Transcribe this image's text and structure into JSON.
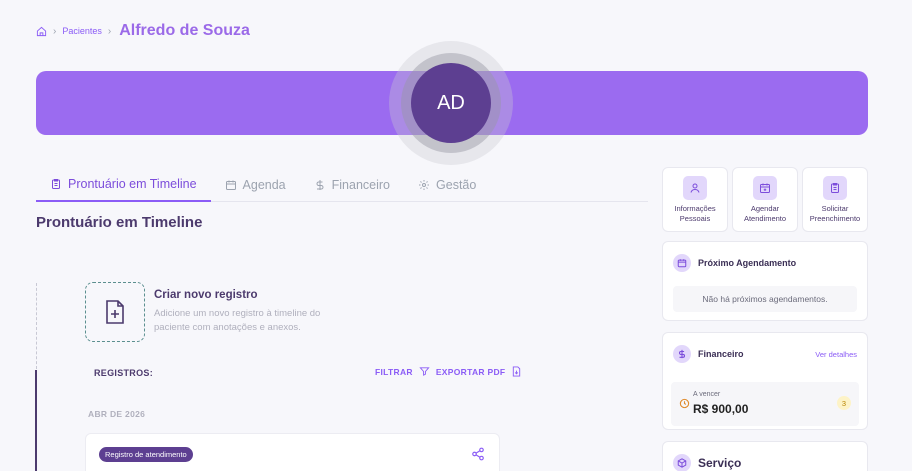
{
  "breadcrumb": {
    "parent": "Pacientes",
    "current": "Alfredo de Souza"
  },
  "avatar": {
    "initials": "AD"
  },
  "tabs": [
    {
      "label": "Prontuário em Timeline",
      "active": true
    },
    {
      "label": "Agenda"
    },
    {
      "label": "Financeiro"
    },
    {
      "label": "Gestão"
    }
  ],
  "section_title": "Prontuário em Timeline",
  "new_record": {
    "title": "Criar novo registro",
    "description": "Adicione um novo registro à timeline do paciente com anotações e anexos."
  },
  "records": {
    "label": "REGISTROS:",
    "filter": "FILTRAR",
    "export": "EXPORTAR PDF"
  },
  "month": "ABR DE 2026",
  "record_badge": "Registro de atendimento",
  "quick_actions": [
    {
      "label": "Informações Pessoais"
    },
    {
      "label": "Agendar Atendimento"
    },
    {
      "label": "Solicitar Preenchimento"
    }
  ],
  "next_appointment": {
    "title": "Próximo Agendamento",
    "empty": "Não há próximos agendamentos."
  },
  "finance": {
    "title": "Financeiro",
    "link": "Ver detalhes",
    "due_label": "A vencer",
    "due_value": "R$ 900,00",
    "count": "3"
  },
  "service": {
    "title": "Serviço"
  },
  "colors": {
    "accent": "#8b5cf6",
    "banner": "#9b6bf0",
    "avatar": "#5d3f91"
  }
}
